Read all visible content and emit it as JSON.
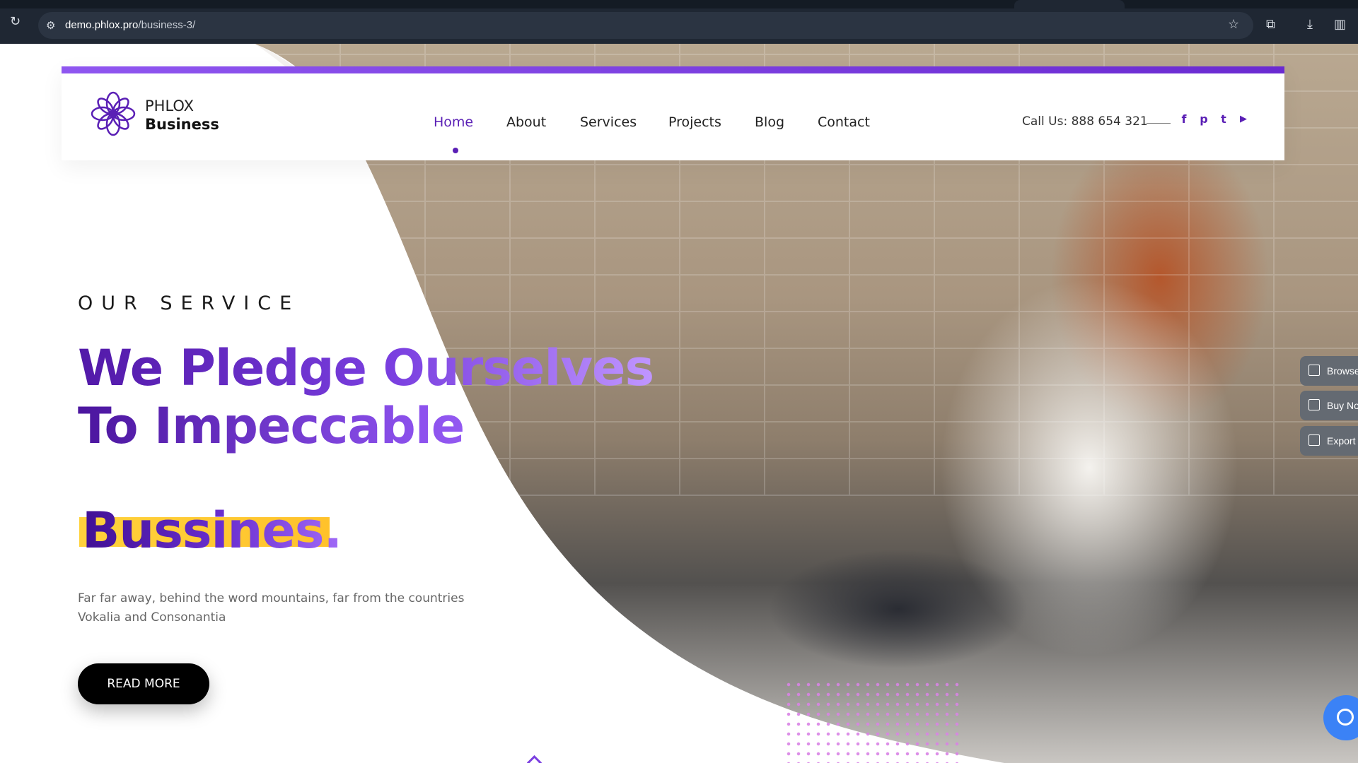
{
  "browser": {
    "url_domain": "demo.phlox.pro",
    "url_path": "/business-3/"
  },
  "header": {
    "brand_line1": "PHLOX",
    "brand_line2": "Business",
    "nav": [
      "Home",
      "About",
      "Services",
      "Projects",
      "Blog",
      "Contact"
    ],
    "active_nav": "Home",
    "call": "Call Us: 888 654 321",
    "social_icons": [
      "facebook-icon",
      "pinterest-icon",
      "twitter-icon",
      "youtube-icon"
    ]
  },
  "hero": {
    "eyebrow": "OUR SERVICE",
    "headline_line1": "We Pledge Ourselves",
    "headline_line2": "To Impeccable",
    "headline_line3": "Bussines.",
    "description": "Far far away, behind the word mountains, far from the countries Vokalia and Consonantia",
    "button": "READ MORE"
  },
  "side_panel": [
    "Browse",
    "Buy No",
    "Export"
  ],
  "colors": {
    "accent": "#5a1fb5",
    "highlight": "#ffc22b"
  }
}
